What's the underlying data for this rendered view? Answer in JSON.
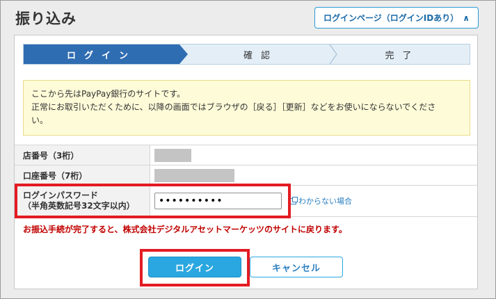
{
  "header": {
    "title": "振り込み",
    "login_page_link": "ログインページ（ログインIDあり）"
  },
  "steps": [
    "ログイン",
    "確認",
    "完了"
  ],
  "notice": {
    "line1": "ここから先はPayPay銀行のサイトです。",
    "line2": "正常にお取引いただくために、以降の画面ではブラウザの［戻る］［更新］などをお使いにならないでくださ",
    "line3": "い。"
  },
  "form": {
    "branch_label": "店番号（3桁）",
    "account_label": "口座番号（7桁）",
    "password_label_1": "ログインパスワード",
    "password_label_2": "（半角英数記号32文字以内）",
    "password_value": "••••••••••",
    "help_link": "わからない場合"
  },
  "return_note": "お振込手続が完了すると、株式会社デジタルアセットマーケッツのサイトに戻ります。",
  "buttons": {
    "login": "ログイン",
    "cancel": "キャンセル"
  },
  "colors": {
    "accent": "#2aa7e0",
    "step_active": "#2f6db2",
    "highlight": "#e31b23",
    "warning_text": "#c00000"
  }
}
